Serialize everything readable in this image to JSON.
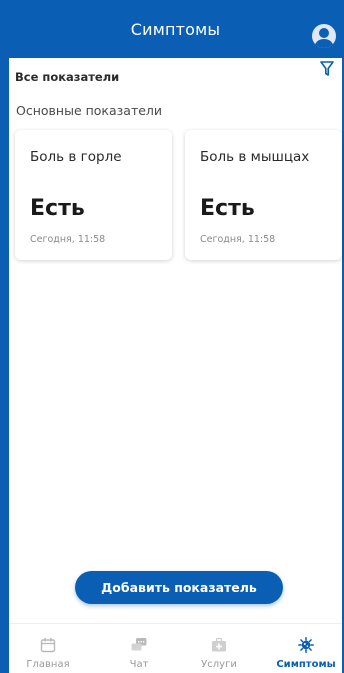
{
  "header": {
    "title": "Симптомы"
  },
  "filter": {
    "label": "Все показатели",
    "icon": "filter-icon"
  },
  "section": {
    "title": "Основные показатели"
  },
  "cards": [
    {
      "title": "Боль в горле",
      "value": "Есть",
      "time": "Сегодня, 11:58"
    },
    {
      "title": "Боль в мышцах",
      "value": "Есть",
      "time": "Сегодня, 11:58"
    }
  ],
  "add_button": {
    "label": "Добавить показатель"
  },
  "tabbar": {
    "items": [
      {
        "label": "Главная",
        "icon": "calendar-icon",
        "active": false
      },
      {
        "label": "Чат",
        "icon": "chat-icon",
        "active": false
      },
      {
        "label": "Услуги",
        "icon": "medical-kit-icon",
        "active": false
      },
      {
        "label": "Симптомы",
        "icon": "virus-icon",
        "active": true
      }
    ]
  },
  "colors": {
    "brand": "#0a5fb4",
    "inactive": "#9a9a9a",
    "card_shadow": "#d6d6d6"
  }
}
